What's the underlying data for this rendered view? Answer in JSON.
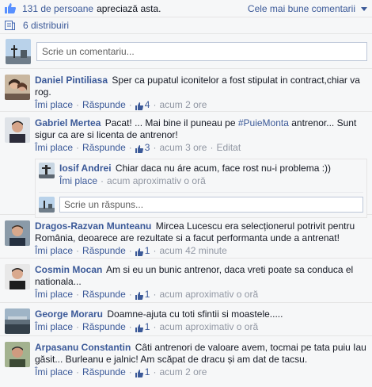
{
  "header": {
    "likes_count": "131 de persoane",
    "likes_suffix": "apreciază asta.",
    "sort_label": "Cele mai bune comentarii",
    "shares_label": "6 distribuiri"
  },
  "composer": {
    "placeholder": "Scrie un comentariu..."
  },
  "actions": {
    "like": "Îmi place",
    "reply": "Răspunde"
  },
  "comments": [
    {
      "author": "Daniel Pintiliasa",
      "text": "Sper ca pupatul iconitelor a fost stipulat in contract,chiar va rog.",
      "likes": "4",
      "time": "acum 2 ore"
    },
    {
      "author": "Gabriel Mertea",
      "text_before": "Pacat! ... Mai bine il puneau pe",
      "hashtag": "#PuieMonta",
      "text_after": "antrenor... Sunt sigur ca are si licenta de antrenor!",
      "likes": "3",
      "time": "acum 3 ore",
      "edited": "Editat",
      "replies": [
        {
          "author": "Iosif Andrei",
          "text": "Chiar daca nu áre acum, face rost nu-i problema :))",
          "time": "acum aproximativ o oră"
        }
      ],
      "reply_placeholder": "Scrie un răspuns..."
    },
    {
      "author": "Dragos-Razvan Munteanu",
      "text": "Mircea Lucescu era selecționerul potrivit pentru România, deoarece are rezultate si a facut performanta unde a antrenat!",
      "likes": "1",
      "time": "acum 42 minute"
    },
    {
      "author": "Cosmin Mocan",
      "text": "Am si eu un bunic antrenor, daca vreti poate sa conduca el nationala...",
      "likes": "1",
      "time": "acum aproximativ o oră"
    },
    {
      "author": "George Moraru",
      "text": "Doamne-ajuta cu toti sfintii si moastele.....",
      "likes": "1",
      "time": "acum aproximativ o oră"
    },
    {
      "author": "Arpasanu Constantin",
      "text": "Câti antrenori de valoare avem, tocmai pe tata puiu Iau găsit... Burleanu e jalnic! Am scăpat de dracu și am dat de tacsu.",
      "likes": "1",
      "time": "acum 2 ore"
    }
  ],
  "colors": {
    "link": "#3b5998",
    "meta": "#9197a3",
    "background": "#f6f7f8"
  }
}
